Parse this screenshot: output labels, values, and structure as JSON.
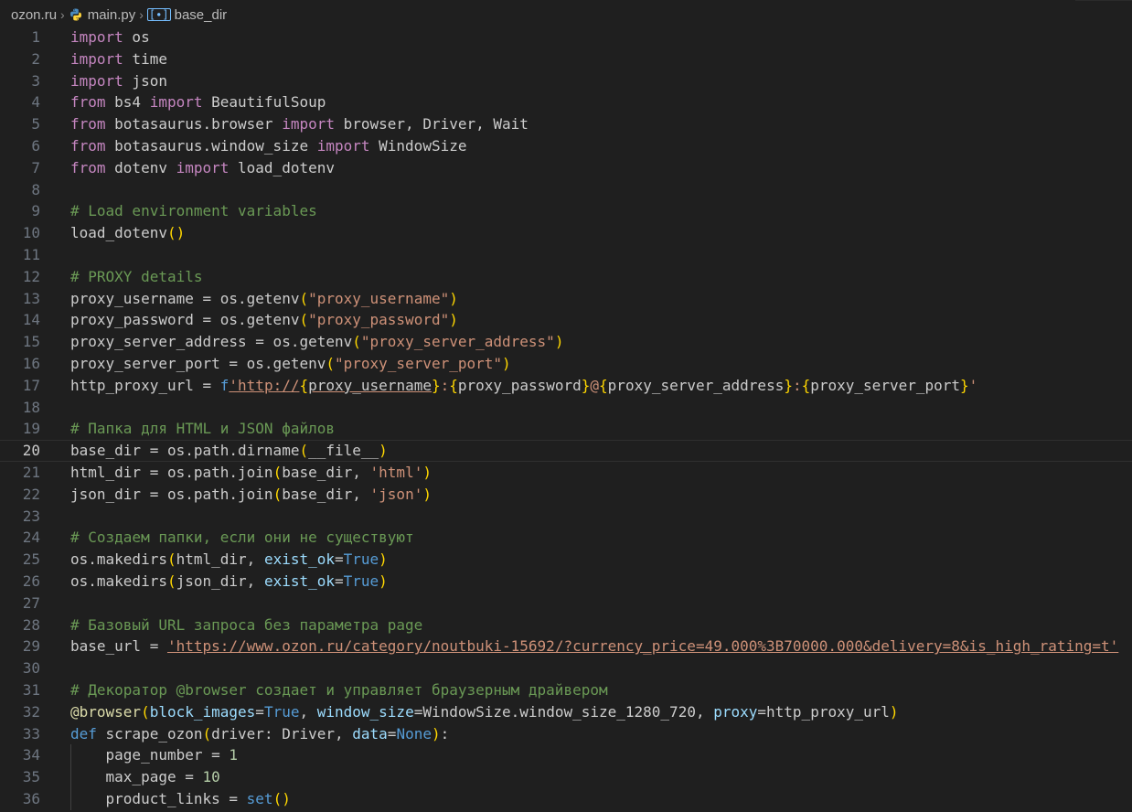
{
  "breadcrumb": {
    "folder": "ozon.ru",
    "file": "main.py",
    "symbol": "base_dir"
  },
  "editor": {
    "current_line": 20,
    "lines": [
      {
        "n": "1",
        "tokens": [
          [
            "kw",
            "import"
          ],
          [
            "plain",
            " os"
          ]
        ]
      },
      {
        "n": "2",
        "tokens": [
          [
            "kw",
            "import"
          ],
          [
            "plain",
            " time"
          ]
        ]
      },
      {
        "n": "3",
        "tokens": [
          [
            "kw",
            "import"
          ],
          [
            "plain",
            " json"
          ]
        ]
      },
      {
        "n": "4",
        "tokens": [
          [
            "kw",
            "from"
          ],
          [
            "plain",
            " bs4 "
          ],
          [
            "kw",
            "import"
          ],
          [
            "plain",
            " BeautifulSoup"
          ]
        ]
      },
      {
        "n": "5",
        "tokens": [
          [
            "kw",
            "from"
          ],
          [
            "plain",
            " botasaurus.browser "
          ],
          [
            "kw",
            "import"
          ],
          [
            "plain",
            " browser, Driver, Wait"
          ]
        ]
      },
      {
        "n": "6",
        "tokens": [
          [
            "kw",
            "from"
          ],
          [
            "plain",
            " botasaurus.window_size "
          ],
          [
            "kw",
            "import"
          ],
          [
            "plain",
            " WindowSize"
          ]
        ]
      },
      {
        "n": "7",
        "tokens": [
          [
            "kw",
            "from"
          ],
          [
            "plain",
            " dotenv "
          ],
          [
            "kw",
            "import"
          ],
          [
            "plain",
            " load_dotenv"
          ]
        ]
      },
      {
        "n": "8",
        "tokens": []
      },
      {
        "n": "9",
        "tokens": [
          [
            "com",
            "# Load environment variables"
          ]
        ]
      },
      {
        "n": "10",
        "tokens": [
          [
            "plain",
            "load_dotenv"
          ],
          [
            "p1",
            "()"
          ]
        ]
      },
      {
        "n": "11",
        "tokens": []
      },
      {
        "n": "12",
        "tokens": [
          [
            "com",
            "# PROXY details"
          ]
        ]
      },
      {
        "n": "13",
        "tokens": [
          [
            "plain",
            "proxy_username = os.getenv"
          ],
          [
            "p1",
            "("
          ],
          [
            "str",
            "\"proxy_username\""
          ],
          [
            "p1",
            ")"
          ]
        ]
      },
      {
        "n": "14",
        "tokens": [
          [
            "plain",
            "proxy_password = os.getenv"
          ],
          [
            "p1",
            "("
          ],
          [
            "str",
            "\"proxy_password\""
          ],
          [
            "p1",
            ")"
          ]
        ]
      },
      {
        "n": "15",
        "tokens": [
          [
            "plain",
            "proxy_server_address = os.getenv"
          ],
          [
            "p1",
            "("
          ],
          [
            "str",
            "\"proxy_server_address\""
          ],
          [
            "p1",
            ")"
          ]
        ]
      },
      {
        "n": "16",
        "tokens": [
          [
            "plain",
            "proxy_server_port = os.getenv"
          ],
          [
            "p1",
            "("
          ],
          [
            "str",
            "\"proxy_server_port\""
          ],
          [
            "p1",
            ")"
          ]
        ]
      },
      {
        "n": "17",
        "tokens": [
          [
            "plain",
            "http_proxy_url = "
          ],
          [
            "kw2",
            "f"
          ],
          [
            "str",
            "'http://"
          ],
          [
            "p1",
            "{"
          ],
          [
            "plain",
            "proxy_username"
          ],
          [
            "p1",
            "}"
          ],
          [
            "str",
            ":"
          ],
          [
            "p1",
            "{"
          ],
          [
            "plain",
            "proxy_password"
          ],
          [
            "p1",
            "}"
          ],
          [
            "str",
            "@"
          ],
          [
            "p1",
            "{"
          ],
          [
            "plain",
            "proxy_server_address"
          ],
          [
            "p1",
            "}"
          ],
          [
            "str",
            ":"
          ],
          [
            "p1",
            "{"
          ],
          [
            "plain",
            "proxy_server_port"
          ],
          [
            "p1",
            "}"
          ],
          [
            "str",
            "'"
          ]
        ]
      },
      {
        "n": "18",
        "tokens": []
      },
      {
        "n": "19",
        "tokens": [
          [
            "com",
            "# Папка для HTML и JSON файлов"
          ]
        ]
      },
      {
        "n": "20",
        "tokens": [
          [
            "plain",
            "base_dir = os.path.dirname"
          ],
          [
            "p1",
            "("
          ],
          [
            "plain",
            "__file__"
          ],
          [
            "p1",
            ")"
          ]
        ]
      },
      {
        "n": "21",
        "tokens": [
          [
            "plain",
            "html_dir = os.path.join"
          ],
          [
            "p1",
            "("
          ],
          [
            "plain",
            "base_dir, "
          ],
          [
            "str",
            "'html'"
          ],
          [
            "p1",
            ")"
          ]
        ]
      },
      {
        "n": "22",
        "tokens": [
          [
            "plain",
            "json_dir = os.path.join"
          ],
          [
            "p1",
            "("
          ],
          [
            "plain",
            "base_dir, "
          ],
          [
            "str",
            "'json'"
          ],
          [
            "p1",
            ")"
          ]
        ]
      },
      {
        "n": "23",
        "tokens": []
      },
      {
        "n": "24",
        "tokens": [
          [
            "com",
            "# Создаем папки, если они не существуют"
          ]
        ]
      },
      {
        "n": "25",
        "tokens": [
          [
            "plain",
            "os.makedirs"
          ],
          [
            "p1",
            "("
          ],
          [
            "plain",
            "html_dir, "
          ],
          [
            "par",
            "exist_ok"
          ],
          [
            "plain",
            "="
          ],
          [
            "kw2",
            "True"
          ],
          [
            "p1",
            ")"
          ]
        ]
      },
      {
        "n": "26",
        "tokens": [
          [
            "plain",
            "os.makedirs"
          ],
          [
            "p1",
            "("
          ],
          [
            "plain",
            "json_dir, "
          ],
          [
            "par",
            "exist_ok"
          ],
          [
            "plain",
            "="
          ],
          [
            "kw2",
            "True"
          ],
          [
            "p1",
            ")"
          ]
        ]
      },
      {
        "n": "27",
        "tokens": []
      },
      {
        "n": "28",
        "tokens": [
          [
            "com",
            "# Базовый URL запроса без параметра page"
          ]
        ]
      },
      {
        "n": "29",
        "tokens": [
          [
            "plain",
            "base_url = "
          ],
          [
            "str",
            "'https://www.ozon.ru/category/noutbuki-15692/?currency_price=49.000%3B70000.000&delivery=8&is_high_rating=t'"
          ]
        ]
      },
      {
        "n": "30",
        "tokens": []
      },
      {
        "n": "31",
        "tokens": [
          [
            "com",
            "# Декоратор @browser создает и управляет браузерным драйвером"
          ]
        ]
      },
      {
        "n": "32",
        "tokens": [
          [
            "fn",
            "@browser"
          ],
          [
            "p1",
            "("
          ],
          [
            "par",
            "block_images"
          ],
          [
            "plain",
            "="
          ],
          [
            "kw2",
            "True"
          ],
          [
            "plain",
            ", "
          ],
          [
            "par",
            "window_size"
          ],
          [
            "plain",
            "=WindowSize.window_size_1280_720, "
          ],
          [
            "par",
            "proxy"
          ],
          [
            "plain",
            "=http_proxy_url"
          ],
          [
            "p1",
            ")"
          ]
        ]
      },
      {
        "n": "33",
        "tokens": [
          [
            "kw2",
            "def"
          ],
          [
            "plain",
            " scrape_ozon"
          ],
          [
            "p1",
            "("
          ],
          [
            "plain",
            "driver: Driver, "
          ],
          [
            "par",
            "data"
          ],
          [
            "plain",
            "="
          ],
          [
            "kw2",
            "None"
          ],
          [
            "p1",
            ")"
          ],
          [
            "plain",
            ":"
          ]
        ]
      },
      {
        "n": "34",
        "tokens": [
          [
            "plain",
            "    page_number = "
          ],
          [
            "num",
            "1"
          ]
        ]
      },
      {
        "n": "35",
        "tokens": [
          [
            "plain",
            "    max_page = "
          ],
          [
            "num",
            "10"
          ]
        ]
      },
      {
        "n": "36",
        "tokens": [
          [
            "plain",
            "    product_links = "
          ],
          [
            "kw2",
            "set"
          ],
          [
            "p1",
            "()"
          ]
        ]
      }
    ]
  }
}
